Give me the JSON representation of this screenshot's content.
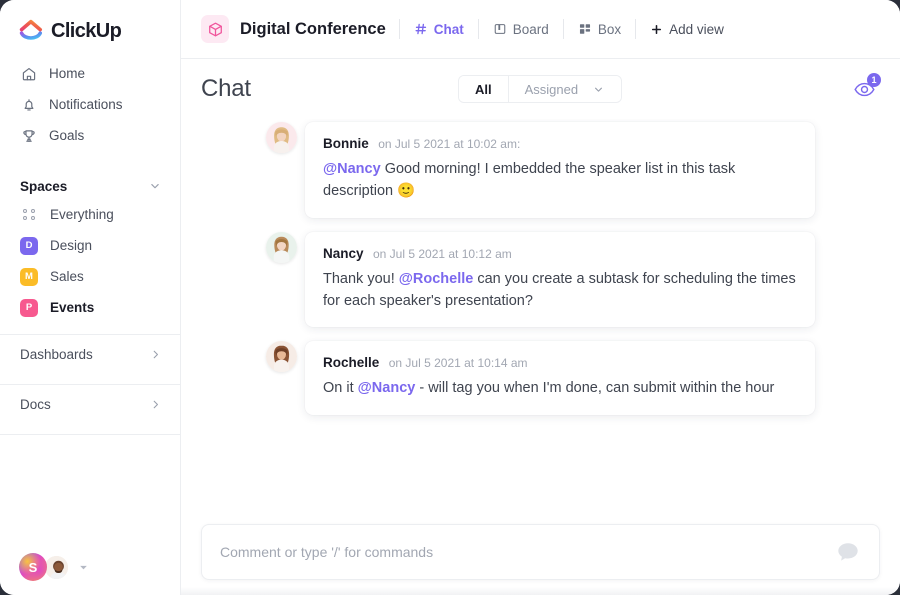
{
  "brand": {
    "name": "ClickUp",
    "accent": "#7b68ee"
  },
  "sidebar": {
    "nav": [
      {
        "label": "Home",
        "icon": "home-icon"
      },
      {
        "label": "Notifications",
        "icon": "bell-icon"
      },
      {
        "label": "Goals",
        "icon": "trophy-icon"
      }
    ],
    "spaces_title": "Spaces",
    "spaces": [
      {
        "label": "Everything",
        "initial": "",
        "color": "",
        "icon": "grid-dots-icon",
        "active": false
      },
      {
        "label": "Design",
        "initial": "D",
        "color": "#7b68ee",
        "active": false
      },
      {
        "label": "Sales",
        "initial": "M",
        "color": "#fbbc27",
        "active": false
      },
      {
        "label": "Events",
        "initial": "P",
        "color": "#f7598f",
        "active": true
      }
    ],
    "footer_items": [
      {
        "label": "Dashboards"
      },
      {
        "label": "Docs"
      }
    ],
    "workspace_initial": "S"
  },
  "header": {
    "project_title": "Digital Conference",
    "project_icon": "cube-icon",
    "tabs": [
      {
        "label": "Chat",
        "icon": "hash-icon",
        "active": true
      },
      {
        "label": "Board",
        "icon": "board-icon",
        "active": false
      },
      {
        "label": "Box",
        "icon": "box-grid-icon",
        "active": false
      }
    ],
    "add_view_label": "Add view"
  },
  "chat": {
    "title": "Chat",
    "filters": [
      {
        "label": "All",
        "active": true,
        "has_chevron": false
      },
      {
        "label": "Assigned",
        "active": false,
        "has_chevron": true
      }
    ],
    "watchers_count": "1",
    "messages": [
      {
        "author": "Bonnie",
        "time": "on Jul 5 2021 at 10:02 am:",
        "avatar_bg": "#fbe9ec",
        "hair": "#e3c08a",
        "skin": "#f2d2bf",
        "parts": [
          {
            "type": "mention",
            "text": "@Nancy"
          },
          {
            "type": "text",
            "text": " Good morning! I embedded the speaker list in this task description 🙂"
          }
        ]
      },
      {
        "author": "Nancy",
        "time": "on Jul 5 2021 at 10:12 am",
        "avatar_bg": "#e9f2ec",
        "hair": "#b98a5a",
        "skin": "#f3d5c3",
        "parts": [
          {
            "type": "text",
            "text": "Thank you! "
          },
          {
            "type": "mention",
            "text": "@Rochelle"
          },
          {
            "type": "text",
            "text": " can you create a subtask for scheduling the times for each speaker's presentation?"
          }
        ]
      },
      {
        "author": "Rochelle",
        "time": "on Jul 5 2021 at 10:14 am",
        "avatar_bg": "#f6ece6",
        "hair": "#8a5334",
        "skin": "#e8b896",
        "parts": [
          {
            "type": "text",
            "text": "On it "
          },
          {
            "type": "mention",
            "text": "@Nancy"
          },
          {
            "type": "text",
            "text": " - will tag you when I'm done, can submit within the hour"
          }
        ]
      }
    ],
    "composer_placeholder": "Comment or type '/' for commands",
    "composer_value": ""
  }
}
